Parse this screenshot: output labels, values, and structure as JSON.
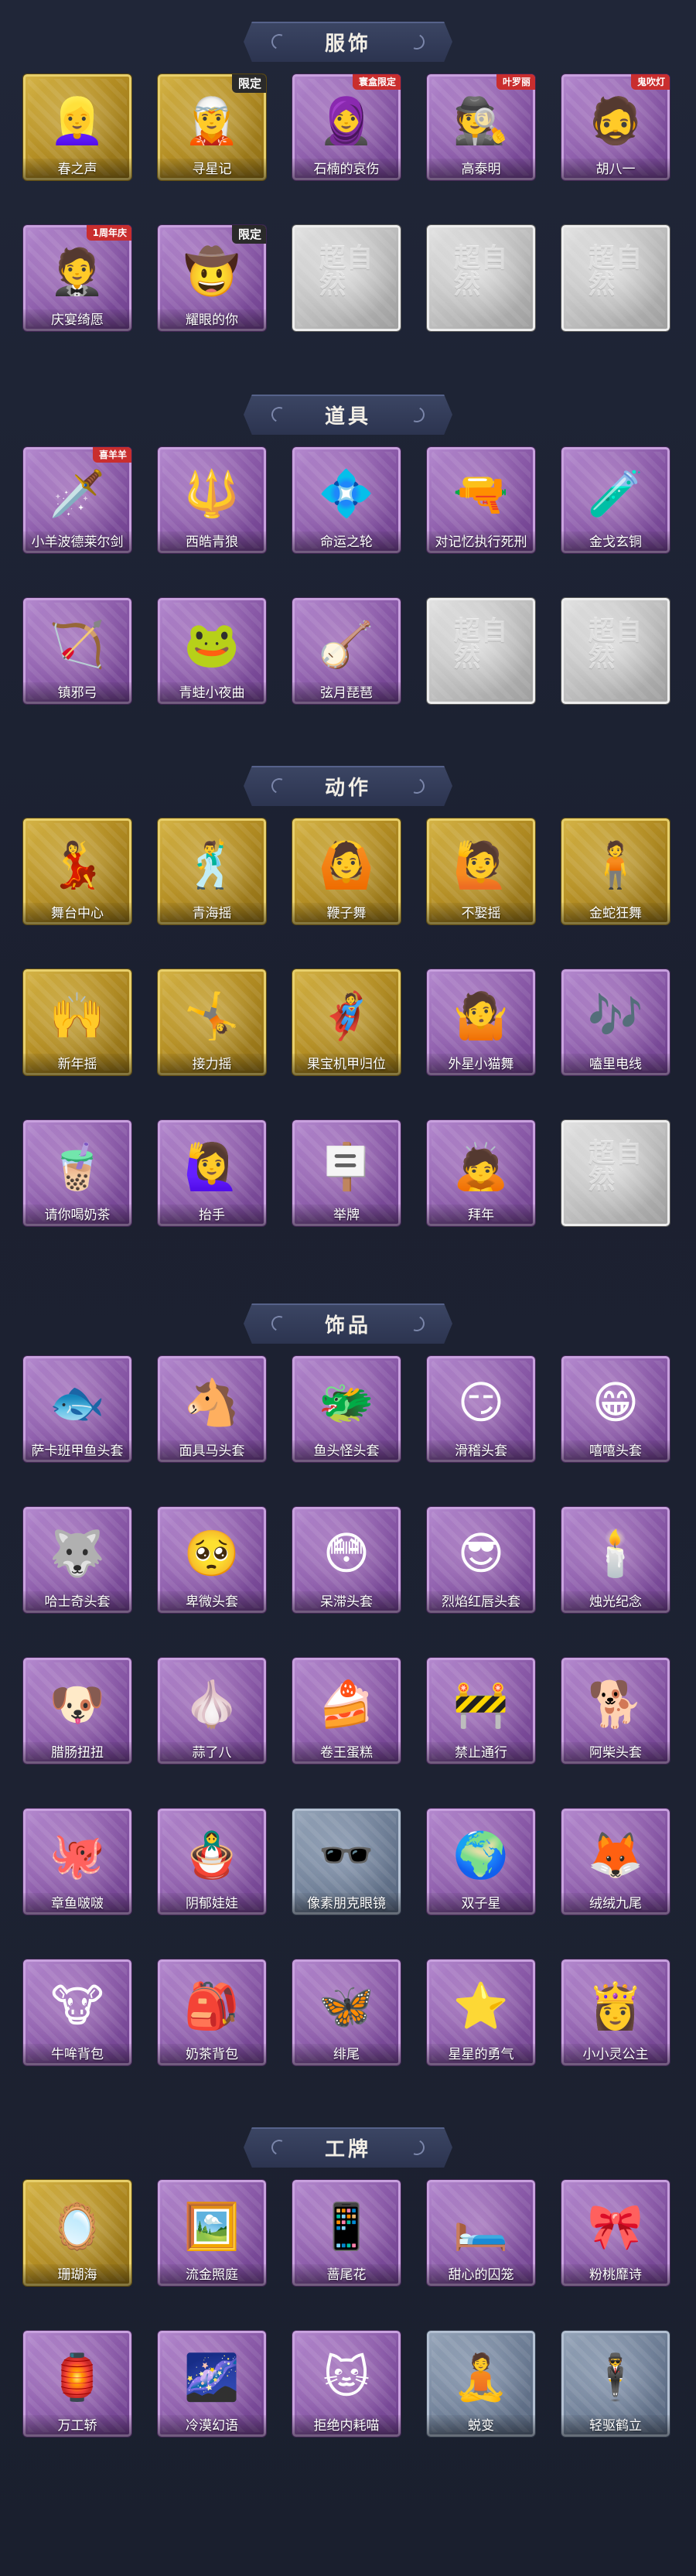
{
  "sections": [
    {
      "title": "服饰",
      "items": [
        {
          "label": "春之声",
          "tier": "gold",
          "icon": "👱‍♀️",
          "icon_name": "blonde-girl-costume-icon",
          "badge": ""
        },
        {
          "label": "寻星记",
          "tier": "gold",
          "icon": "🧝",
          "icon_name": "adventurer-costume-icon",
          "badge": "限定"
        },
        {
          "label": "石楠的哀伤",
          "tier": "purple",
          "icon": "🧕",
          "icon_name": "silver-haired-costume-icon",
          "badge": "寰盒限定"
        },
        {
          "label": "高泰明",
          "tier": "purple",
          "icon": "🕵️",
          "icon_name": "detective-costume-icon",
          "badge": "叶罗丽"
        },
        {
          "label": "胡八一",
          "tier": "purple",
          "icon": "🧔",
          "icon_name": "explorer-costume-icon",
          "badge": "鬼吹灯"
        },
        {
          "label": "庆宴绮愿",
          "tier": "purple",
          "icon": "🤵",
          "icon_name": "banquet-costume-icon",
          "badge": "1周年庆"
        },
        {
          "label": "耀眼的你",
          "tier": "purple",
          "icon": "🤠",
          "icon_name": "cowgirl-costume-icon",
          "badge": "限定"
        },
        {
          "label": "",
          "tier": "silver",
          "icon": "超自然",
          "icon_name": "placeholder-logo-icon",
          "badge": ""
        },
        {
          "label": "",
          "tier": "silver",
          "icon": "超自然",
          "icon_name": "placeholder-logo-icon",
          "badge": ""
        },
        {
          "label": "",
          "tier": "silver",
          "icon": "超自然",
          "icon_name": "placeholder-logo-icon",
          "badge": ""
        }
      ]
    },
    {
      "title": "道具",
      "items": [
        {
          "label": "小羊波德莱尔剑",
          "tier": "purple",
          "icon": "🗡️",
          "icon_name": "sword-icon",
          "badge": "喜羊羊"
        },
        {
          "label": "西皓青狼",
          "tier": "purple",
          "icon": "🔱",
          "icon_name": "staff-icon",
          "badge": ""
        },
        {
          "label": "命运之轮",
          "tier": "purple",
          "icon": "💠",
          "icon_name": "wheel-icon",
          "badge": ""
        },
        {
          "label": "对记忆执行死刑",
          "tier": "purple",
          "icon": "🔫",
          "icon_name": "pistol-icon",
          "badge": ""
        },
        {
          "label": "金戈玄铜",
          "tier": "purple",
          "icon": "🧪",
          "icon_name": "bronze-canister-icon",
          "badge": ""
        },
        {
          "label": "镇邪弓",
          "tier": "purple",
          "icon": "🏹",
          "icon_name": "bow-icon",
          "badge": ""
        },
        {
          "label": "青蛙小夜曲",
          "tier": "purple",
          "icon": "🐸",
          "icon_name": "frog-icon",
          "badge": ""
        },
        {
          "label": "弦月琵琶",
          "tier": "purple",
          "icon": "🪕",
          "icon_name": "pipa-icon",
          "badge": ""
        },
        {
          "label": "",
          "tier": "silver",
          "icon": "超自然",
          "icon_name": "placeholder-logo-icon",
          "badge": ""
        },
        {
          "label": "",
          "tier": "silver",
          "icon": "超自然",
          "icon_name": "placeholder-logo-icon",
          "badge": ""
        }
      ]
    },
    {
      "title": "动作",
      "items": [
        {
          "label": "舞台中心",
          "tier": "gold",
          "icon": "💃",
          "icon_name": "dance-pose-icon",
          "badge": ""
        },
        {
          "label": "青海摇",
          "tier": "gold",
          "icon": "🕺",
          "icon_name": "dance-pose-icon",
          "badge": ""
        },
        {
          "label": "鞭子舞",
          "tier": "gold",
          "icon": "🙆",
          "icon_name": "dance-pose-icon",
          "badge": ""
        },
        {
          "label": "不娶摇",
          "tier": "gold",
          "icon": "🙋",
          "icon_name": "dance-pose-icon",
          "badge": ""
        },
        {
          "label": "金蛇狂舞",
          "tier": "gold",
          "icon": "🧍",
          "icon_name": "dance-pose-icon",
          "badge": ""
        },
        {
          "label": "新年摇",
          "tier": "gold",
          "icon": "🙌",
          "icon_name": "dance-pose-icon",
          "badge": ""
        },
        {
          "label": "接力摇",
          "tier": "gold",
          "icon": "🤸",
          "icon_name": "dance-pose-icon",
          "badge": ""
        },
        {
          "label": "果宝机甲归位",
          "tier": "gold",
          "icon": "🦸",
          "icon_name": "dance-pose-icon",
          "badge": ""
        },
        {
          "label": "外星小猫舞",
          "tier": "purple",
          "icon": "🤷",
          "icon_name": "dance-pose-icon",
          "badge": ""
        },
        {
          "label": "嗑里电线",
          "tier": "purple",
          "icon": "🎶",
          "icon_name": "dance-pose-icon",
          "badge": ""
        },
        {
          "label": "请你喝奶茶",
          "tier": "purple",
          "icon": "🧋",
          "icon_name": "milk-tea-pose-icon",
          "badge": ""
        },
        {
          "label": "抬手",
          "tier": "purple",
          "icon": "🙋‍♀️",
          "icon_name": "raise-hand-pose-icon",
          "badge": ""
        },
        {
          "label": "举牌",
          "tier": "purple",
          "icon": "🪧",
          "icon_name": "sign-pose-icon",
          "badge": ""
        },
        {
          "label": "拜年",
          "tier": "purple",
          "icon": "🙇",
          "icon_name": "bow-pose-icon",
          "badge": ""
        },
        {
          "label": "",
          "tier": "silver",
          "icon": "超自然",
          "icon_name": "placeholder-logo-icon",
          "badge": ""
        }
      ]
    },
    {
      "title": "饰品",
      "items": [
        {
          "label": "萨卡班甲鱼头套",
          "tier": "purple",
          "icon": "🐟",
          "icon_name": "fish-headgear-icon",
          "badge": ""
        },
        {
          "label": "面具马头套",
          "tier": "purple",
          "icon": "🐴",
          "icon_name": "horse-headgear-icon",
          "badge": ""
        },
        {
          "label": "鱼头怪头套",
          "tier": "purple",
          "icon": "🐲",
          "icon_name": "fish-monster-headgear-icon",
          "badge": ""
        },
        {
          "label": "滑稽头套",
          "tier": "purple",
          "icon": "😏",
          "icon_name": "funny-face-headgear-icon",
          "badge": ""
        },
        {
          "label": "嘻嘻头套",
          "tier": "purple",
          "icon": "😁",
          "icon_name": "grin-headgear-icon",
          "badge": ""
        },
        {
          "label": "哈士奇头套",
          "tier": "purple",
          "icon": "🐺",
          "icon_name": "husky-headgear-icon",
          "badge": ""
        },
        {
          "label": "卑微头套",
          "tier": "purple",
          "icon": "🥺",
          "icon_name": "humble-headgear-icon",
          "badge": ""
        },
        {
          "label": "呆滞头套",
          "tier": "purple",
          "icon": "😳",
          "icon_name": "stunned-headgear-icon",
          "badge": ""
        },
        {
          "label": "烈焰红唇头套",
          "tier": "purple",
          "icon": "😎",
          "icon_name": "red-lips-headgear-icon",
          "badge": ""
        },
        {
          "label": "烛光纪念",
          "tier": "purple",
          "icon": "🕯️",
          "icon_name": "candle-headgear-icon",
          "badge": ""
        },
        {
          "label": "腊肠扭扭",
          "tier": "purple",
          "icon": "🐶",
          "icon_name": "dachshund-headgear-icon",
          "badge": ""
        },
        {
          "label": "蒜了八",
          "tier": "purple",
          "icon": "🧄",
          "icon_name": "garlic-headgear-icon",
          "badge": ""
        },
        {
          "label": "卷王蛋糕",
          "tier": "purple",
          "icon": "🍰",
          "icon_name": "cake-headgear-icon",
          "badge": ""
        },
        {
          "label": "禁止通行",
          "tier": "purple",
          "icon": "🚧",
          "icon_name": "traffic-cone-headgear-icon",
          "badge": ""
        },
        {
          "label": "阿柴头套",
          "tier": "purple",
          "icon": "🐕",
          "icon_name": "shiba-headgear-icon",
          "badge": ""
        },
        {
          "label": "章鱼啵啵",
          "tier": "purple",
          "icon": "🐙",
          "icon_name": "octopus-accessory-icon",
          "badge": ""
        },
        {
          "label": "阴郁娃娃",
          "tier": "purple",
          "icon": "🪆",
          "icon_name": "doll-accessory-icon",
          "badge": ""
        },
        {
          "label": "像素朋克眼镜",
          "tier": "bluegray",
          "icon": "🕶️",
          "icon_name": "pixel-glasses-icon",
          "badge": ""
        },
        {
          "label": "双子星",
          "tier": "purple",
          "icon": "🌍",
          "icon_name": "twin-star-accessory-icon",
          "badge": ""
        },
        {
          "label": "绒绒九尾",
          "tier": "purple",
          "icon": "🦊",
          "icon_name": "nine-tail-accessory-icon",
          "badge": ""
        },
        {
          "label": "牛哞背包",
          "tier": "purple",
          "icon": "🐮",
          "icon_name": "cow-backpack-icon",
          "badge": ""
        },
        {
          "label": "奶茶背包",
          "tier": "purple",
          "icon": "🎒",
          "icon_name": "milk-tea-backpack-icon",
          "badge": ""
        },
        {
          "label": "绯尾",
          "tier": "purple",
          "icon": "🦋",
          "icon_name": "red-tail-accessory-icon",
          "badge": ""
        },
        {
          "label": "星星的勇气",
          "tier": "purple",
          "icon": "⭐",
          "icon_name": "star-courage-accessory-icon",
          "badge": ""
        },
        {
          "label": "小小灵公主",
          "tier": "purple",
          "icon": "👸",
          "icon_name": "little-princess-accessory-icon",
          "badge": ""
        }
      ]
    },
    {
      "title": "工牌",
      "items": [
        {
          "label": "珊瑚海",
          "tier": "gold",
          "icon": "🪞",
          "icon_name": "coral-sea-badge-icon",
          "badge": ""
        },
        {
          "label": "流金照庭",
          "tier": "purple",
          "icon": "🖼️",
          "icon_name": "golden-court-badge-icon",
          "badge": ""
        },
        {
          "label": "蔷尾花",
          "tier": "purple",
          "icon": "📱",
          "icon_name": "iris-badge-icon",
          "badge": ""
        },
        {
          "label": "甜心的囚笼",
          "tier": "purple",
          "icon": "🛏️",
          "icon_name": "sweetheart-cage-badge-icon",
          "badge": ""
        },
        {
          "label": "粉桃靡诗",
          "tier": "purple",
          "icon": "🎀",
          "icon_name": "pink-peach-badge-icon",
          "badge": ""
        },
        {
          "label": "万工轿",
          "tier": "purple",
          "icon": "🏮",
          "icon_name": "sedan-badge-icon",
          "badge": ""
        },
        {
          "label": "冷漠幻语",
          "tier": "purple",
          "icon": "🌌",
          "icon_name": "cold-dream-badge-icon",
          "badge": ""
        },
        {
          "label": "拒绝内耗喵",
          "tier": "purple",
          "icon": "🐱",
          "icon_name": "cat-badge-icon",
          "badge": ""
        },
        {
          "label": "蜕变",
          "tier": "bluegray",
          "icon": "🧘",
          "icon_name": "metamorphosis-badge-icon",
          "badge": ""
        },
        {
          "label": "轻驱鹤立",
          "tier": "bluegray",
          "icon": "🕴️",
          "icon_name": "crane-stand-badge-icon",
          "badge": ""
        }
      ]
    }
  ]
}
